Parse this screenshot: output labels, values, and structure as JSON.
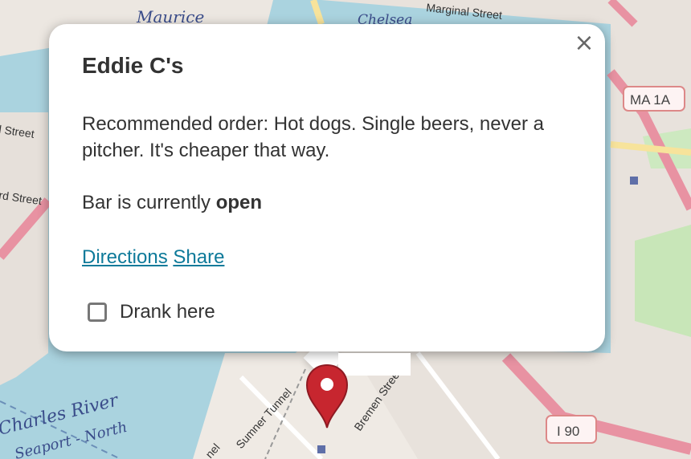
{
  "map": {
    "labels": {
      "maurice": "Maurice",
      "chelsea": "Chelsea",
      "marginal_street": "Marginal Street",
      "l_street": "l Street",
      "rd_street": "rd Street",
      "charles_river": "Charles River",
      "seaport_north": "Seaport - North",
      "sumner_tunnel": "Sumner Tunnel",
      "bremen_street": "Bremen Street",
      "nel": "nel",
      "ma_1a": "MA 1A",
      "i90": "I 90"
    }
  },
  "popup": {
    "close_label": "×",
    "title": "Eddie C's",
    "description": "Recommended order: Hot dogs. Single beers, never a pitcher. It's cheaper that way.",
    "status_prefix": "Bar is currently ",
    "status_value": "open",
    "directions_label": "Directions",
    "share_label": "Share",
    "checkbox_label": "Drank here",
    "checkbox_checked": false
  },
  "colors": {
    "link": "#0e7a9a",
    "marker": "#c7262f",
    "water": "#aad3df"
  }
}
